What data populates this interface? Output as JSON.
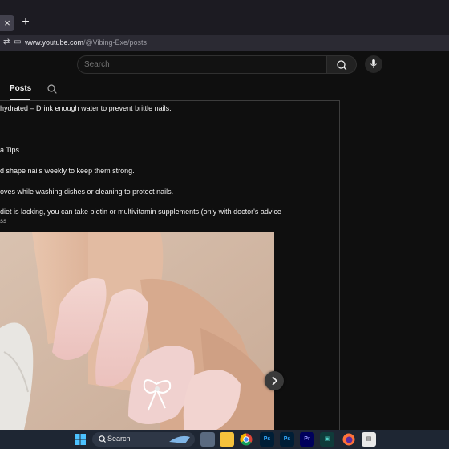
{
  "browser": {
    "tab_close": "×",
    "new_tab": "+",
    "url_host": "www.youtube.com",
    "url_path": "/@Vibing-Exe/posts"
  },
  "header": {
    "search_placeholder": "Search"
  },
  "channel_tabs": {
    "active": "Posts"
  },
  "post": {
    "lines": [
      "hydrated – Drink enough water to prevent brittle nails.",
      "a Tips",
      "d shape nails weekly to keep them strong.",
      "oves while washing dishes or cleaning to protect nails.",
      "diet is lacking, you can take biotin or multivitamin supplements (only with doctor's advice",
      "ss"
    ]
  },
  "taskbar": {
    "search_label": "Search",
    "apps": [
      "start-icon",
      "file-explorer-icon",
      "chrome-icon",
      "photoshop-icon",
      "photoshop-icon-2",
      "premiere-icon",
      "app-icon",
      "firefox-icon",
      "app-icon-2"
    ]
  },
  "colors": {
    "background": "#0f0f0f",
    "text": "#f1f1f1",
    "accent_blue": "#3ea6ff"
  }
}
